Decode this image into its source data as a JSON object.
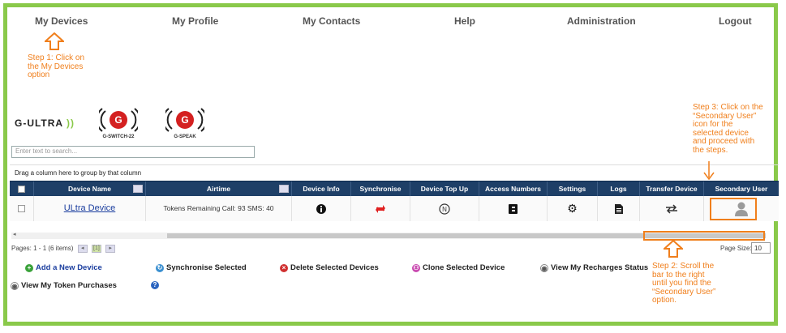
{
  "nav": {
    "items": [
      "My Devices",
      "My Profile",
      "My Contacts",
      "Help",
      "Administration",
      "Logout"
    ]
  },
  "annotations": {
    "step1": "Step 1: Click on the My Devices option",
    "step2": "Step 2: Scroll the bar to the right until you find the “Secondary User” option.",
    "step3": "Step 3: Click on the “Secondary User” icon for the selected device and proceed with the steps."
  },
  "logos": {
    "gultra": "G-ULTRA",
    "gswitch": "G-SWITCH-22",
    "gspeak": "G-SPEAK"
  },
  "search": {
    "placeholder": "Enter text to search..."
  },
  "grid": {
    "group_hint": "Drag a column here to group by that column",
    "columns": [
      "Device Name",
      "Airtime",
      "Device Info",
      "Synchronise",
      "Device Top Up",
      "Access Numbers",
      "Settings",
      "Logs",
      "Transfer Device",
      "Secondary User"
    ],
    "rows": [
      {
        "device_name": "ULtra Device",
        "airtime": "Tokens Remaining Call: 93 SMS: 40"
      }
    ]
  },
  "pager": {
    "summary": "Pages: 1 - 1 (6 items)",
    "current": "[1]",
    "page_size_label": "Page Size:",
    "page_size": "10"
  },
  "actions": {
    "add": "Add a New Device",
    "sync": "Synchronise Selected",
    "delete": "Delete Selected Devices",
    "clone": "Clone Selected Device",
    "recharges": "View My Recharges Status",
    "tokens": "View My Token Purchases"
  },
  "colors": {
    "accent": "#8ac94a",
    "header": "#1e3f67",
    "annotation": "#f07f1c"
  }
}
